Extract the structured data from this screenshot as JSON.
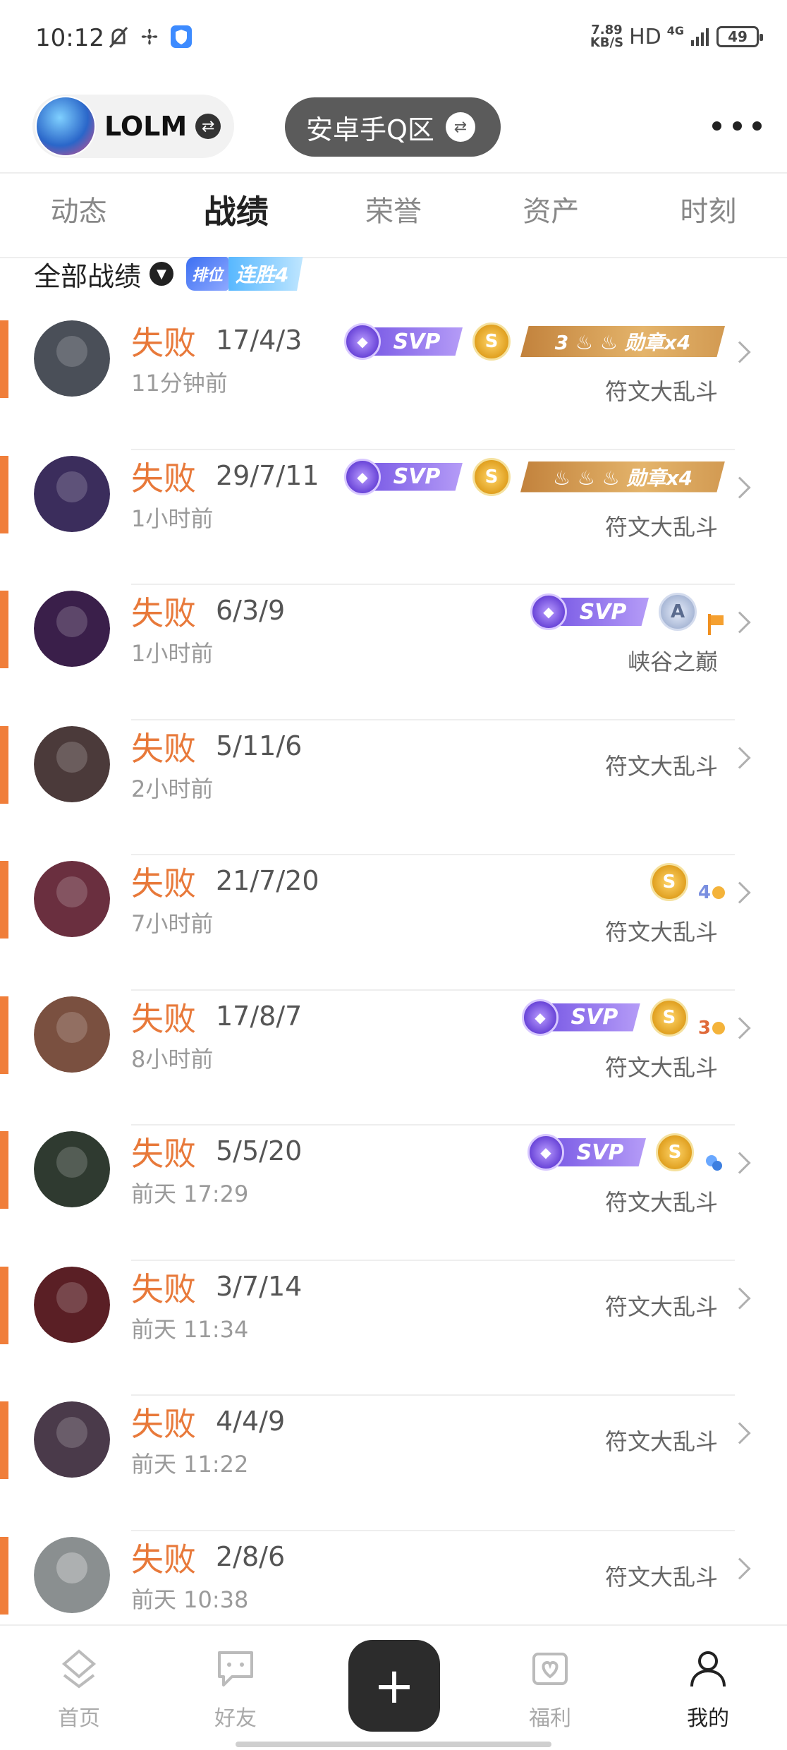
{
  "status_bar": {
    "time": "10:12",
    "speed_value": "7.89",
    "speed_unit": "KB/S",
    "hd": "HD",
    "network": "4G",
    "battery": "49"
  },
  "header": {
    "game_name": "LOLM",
    "server": "安卓手Q区"
  },
  "tabs": [
    {
      "label": "动态",
      "active": false
    },
    {
      "label": "战绩",
      "active": true
    },
    {
      "label": "荣誉",
      "active": false
    },
    {
      "label": "资产",
      "active": false
    },
    {
      "label": "时刻",
      "active": false
    }
  ],
  "filter": {
    "label": "全部战绩",
    "streak_rank": "排位",
    "streak_text": "连胜4"
  },
  "badge_labels": {
    "svp": "SVP",
    "s": "S",
    "a": "A",
    "medal_1": "3 ♨ ♨ 勋章x4",
    "medal_2": "♨ ♨ ♨ 勋章x4",
    "count_4": "4",
    "count_3": "3"
  },
  "matches": [
    {
      "result": "失败",
      "kda": "17/4/3",
      "time": "11分钟前",
      "mode": "符文大乱斗",
      "avatar_color": "#4a4f58"
    },
    {
      "result": "失败",
      "kda": "29/7/11",
      "time": "1小时前",
      "mode": "符文大乱斗",
      "avatar_color": "#3b2d5c"
    },
    {
      "result": "失败",
      "kda": "6/3/9",
      "time": "1小时前",
      "mode": "峡谷之巅",
      "avatar_color": "#3a1f4a"
    },
    {
      "result": "失败",
      "kda": "5/11/6",
      "time": "2小时前",
      "mode": "符文大乱斗",
      "avatar_color": "#4b3a3a"
    },
    {
      "result": "失败",
      "kda": "21/7/20",
      "time": "7小时前",
      "mode": "符文大乱斗",
      "avatar_color": "#6a2f3f"
    },
    {
      "result": "失败",
      "kda": "17/8/7",
      "time": "8小时前",
      "mode": "符文大乱斗",
      "avatar_color": "#7a5040"
    },
    {
      "result": "失败",
      "kda": "5/5/20",
      "time": "前天 17:29",
      "mode": "符文大乱斗",
      "avatar_color": "#2f3a30"
    },
    {
      "result": "失败",
      "kda": "3/7/14",
      "time": "前天 11:34",
      "mode": "符文大乱斗",
      "avatar_color": "#5a1f25"
    },
    {
      "result": "失败",
      "kda": "4/4/9",
      "time": "前天 11:22",
      "mode": "符文大乱斗",
      "avatar_color": "#4a3a4a"
    },
    {
      "result": "失败",
      "kda": "2/8/6",
      "time": "前天 10:38",
      "mode": "符文大乱斗",
      "avatar_color": "#8a8f90"
    }
  ],
  "bottom_nav": [
    {
      "label": "首页",
      "icon": "home-icon"
    },
    {
      "label": "好友",
      "icon": "chat-icon"
    },
    {
      "label": "福利",
      "icon": "gift-icon"
    },
    {
      "label": "我的",
      "icon": "profile-icon",
      "active": true
    }
  ],
  "colors": {
    "loss": "#e8793a",
    "accent_bar": "#f07e3a"
  }
}
